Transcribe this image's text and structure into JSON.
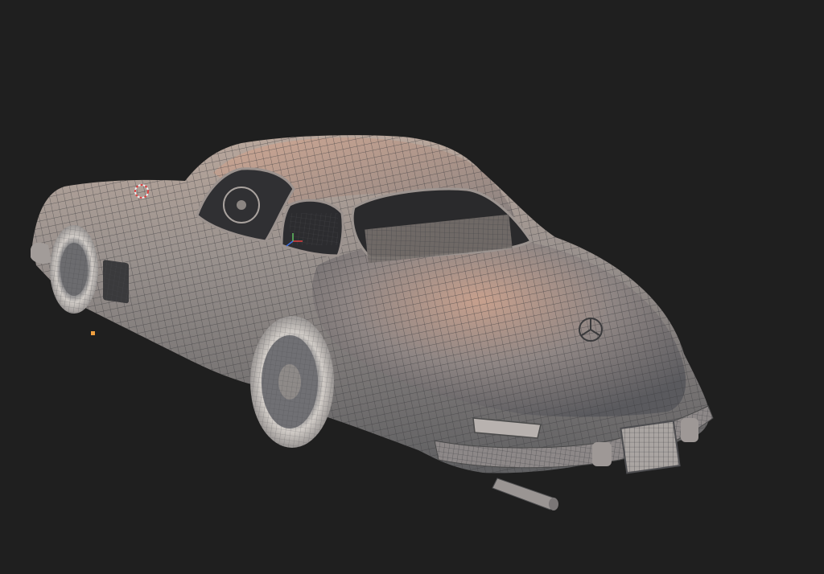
{
  "viewport": {
    "background": "#1f1f1f",
    "object": "car-wireframe-model",
    "mesh_color": "#8e8e8e",
    "wire_color": "#4a4a4a",
    "highlight_color": "#d9a58a",
    "light_marker_color": "#f0a040"
  }
}
